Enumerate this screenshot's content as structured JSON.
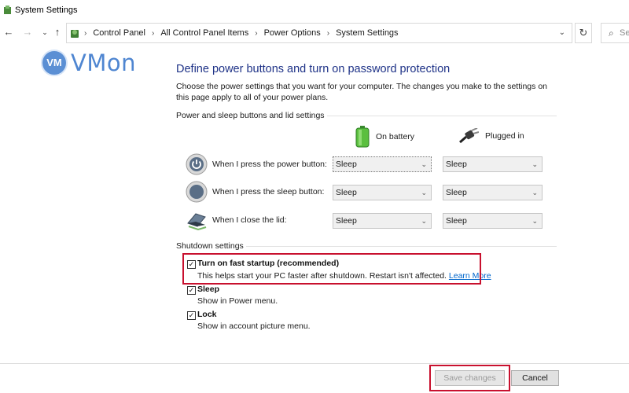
{
  "window": {
    "title": "System Settings"
  },
  "nav": {
    "back_icon": "←",
    "forward_icon": "→",
    "recent_icon": "⌄",
    "up_icon": "↑",
    "crumbs": [
      "Control Panel",
      "All Control Panel Items",
      "Power Options",
      "System Settings"
    ],
    "crumb_separator": "›",
    "dropdown_icon": "⌄",
    "refresh_icon": "↻",
    "search_icon": "⌕",
    "search_placeholder": "Se"
  },
  "watermark": {
    "badge": "VM",
    "text": "VMon"
  },
  "main": {
    "title": "Define power buttons and turn on password protection",
    "intro": "Choose the power settings that you want for your computer. The changes you make to the settings on this page apply to all of your power plans.",
    "power_group_label": "Power and sleep buttons and lid settings",
    "columns": {
      "battery": "On battery",
      "plugged": "Plugged in"
    },
    "rows": [
      {
        "label": "When I press the power button:",
        "battery": "Sleep",
        "plugged": "Sleep"
      },
      {
        "label": "When I press the sleep button:",
        "battery": "Sleep",
        "plugged": "Sleep"
      },
      {
        "label": "When I close the lid:",
        "battery": "Sleep",
        "plugged": "Sleep"
      }
    ],
    "shutdown_group_label": "Shutdown settings",
    "shutdown_options": [
      {
        "title": "Turn on fast startup (recommended)",
        "desc": "This helps start your PC faster after shutdown. Restart isn't affected.",
        "link": "Learn More",
        "checked": true
      },
      {
        "title": "Sleep",
        "desc": "Show in Power menu.",
        "checked": true
      },
      {
        "title": "Lock",
        "desc": "Show in account picture menu.",
        "checked": true
      }
    ],
    "checkmark": "✓",
    "select_arrow": "⌄"
  },
  "footer": {
    "save_label": "Save changes",
    "cancel_label": "Cancel"
  },
  "colors": {
    "title_blue": "#1e3287",
    "highlight_red": "#c8102e",
    "link_blue": "#0066cc"
  }
}
